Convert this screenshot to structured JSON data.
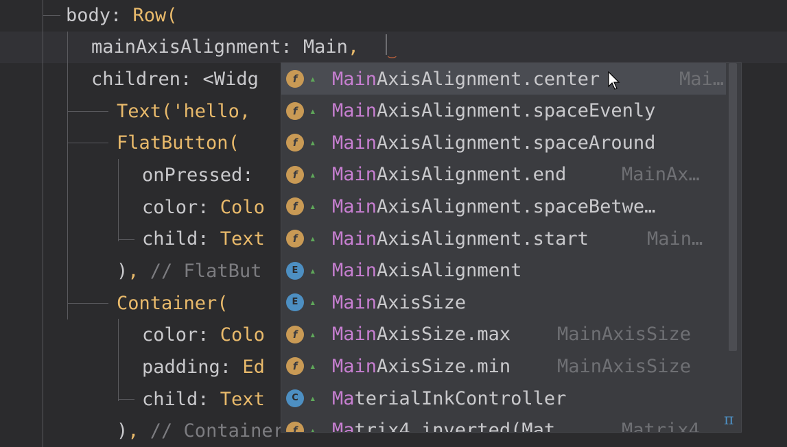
{
  "editor": {
    "lines": [
      {
        "indent": "body: ",
        "token": "Row",
        "tail": "("
      },
      {
        "indent": "mainAxisAlignment: ",
        "token": "Main",
        "tail": ","
      },
      {
        "indent": "children: <Widg",
        "token": "",
        "tail": ""
      },
      {
        "indent": "",
        "token": "Text",
        "tail": "('hello, "
      },
      {
        "indent": "",
        "token": "FlatButton",
        "tail": "("
      },
      {
        "indent": "onPressed: ",
        "token": "",
        "tail": ""
      },
      {
        "indent": "color: ",
        "token": "Colo",
        "tail": ""
      },
      {
        "indent": "child: ",
        "token": "Text",
        "tail": ""
      },
      {
        "indent": ")",
        "token": ",",
        "tail": " // FlatBut"
      },
      {
        "indent": "",
        "token": "Container",
        "tail": "("
      },
      {
        "indent": "color: ",
        "token": "Colo",
        "tail": ""
      },
      {
        "indent": "padding: ",
        "token": "Ed",
        "tail": ""
      },
      {
        "indent": "child: ",
        "token": "Text",
        "tail": ""
      },
      {
        "indent": ")",
        "token": ",",
        "tail": " // Container"
      }
    ]
  },
  "completion": {
    "items": [
      {
        "match": "Main",
        "rest": "AxisAlignment.center",
        "type": "Mai…",
        "icon": "field-icon",
        "icon_char": "f"
      },
      {
        "match": "Main",
        "rest": "AxisAlignment.spaceEvenly",
        "type": "",
        "icon": "field-icon",
        "icon_char": "f"
      },
      {
        "match": "Main",
        "rest": "AxisAlignment.spaceAround",
        "type": "",
        "icon": "field-icon",
        "icon_char": "f"
      },
      {
        "match": "Main",
        "rest": "AxisAlignment.end",
        "type": "MainAx…",
        "icon": "field-icon",
        "icon_char": "f"
      },
      {
        "match": "Main",
        "rest": "AxisAlignment.spaceBetwe…",
        "type": "",
        "icon": "field-icon",
        "icon_char": "f"
      },
      {
        "match": "Main",
        "rest": "AxisAlignment.start",
        "type": "Main…",
        "icon": "field-icon",
        "icon_char": "f"
      },
      {
        "match": "Main",
        "rest": "AxisAlignment",
        "type": "",
        "icon": "enum-icon",
        "icon_char": "E"
      },
      {
        "match": "Main",
        "rest": "AxisSize",
        "type": "",
        "icon": "enum-icon",
        "icon_char": "E"
      },
      {
        "match": "Main",
        "rest": "AxisSize.max",
        "type": "MainAxisSize",
        "icon": "field-icon",
        "icon_char": "f"
      },
      {
        "match": "Main",
        "rest": "AxisSize.min",
        "type": "MainAxisSize",
        "icon": "field-icon",
        "icon_char": "f"
      },
      {
        "match": "Ma",
        "rest": "terialInkController",
        "type": "",
        "icon": "class-icon",
        "icon_char": "C"
      },
      {
        "match": "Ma",
        "rest": "trix4.inverted(Mat…",
        "type": "Matrix4",
        "icon": "field-icon",
        "icon_char": "f"
      }
    ],
    "footer_symbol": "π"
  }
}
